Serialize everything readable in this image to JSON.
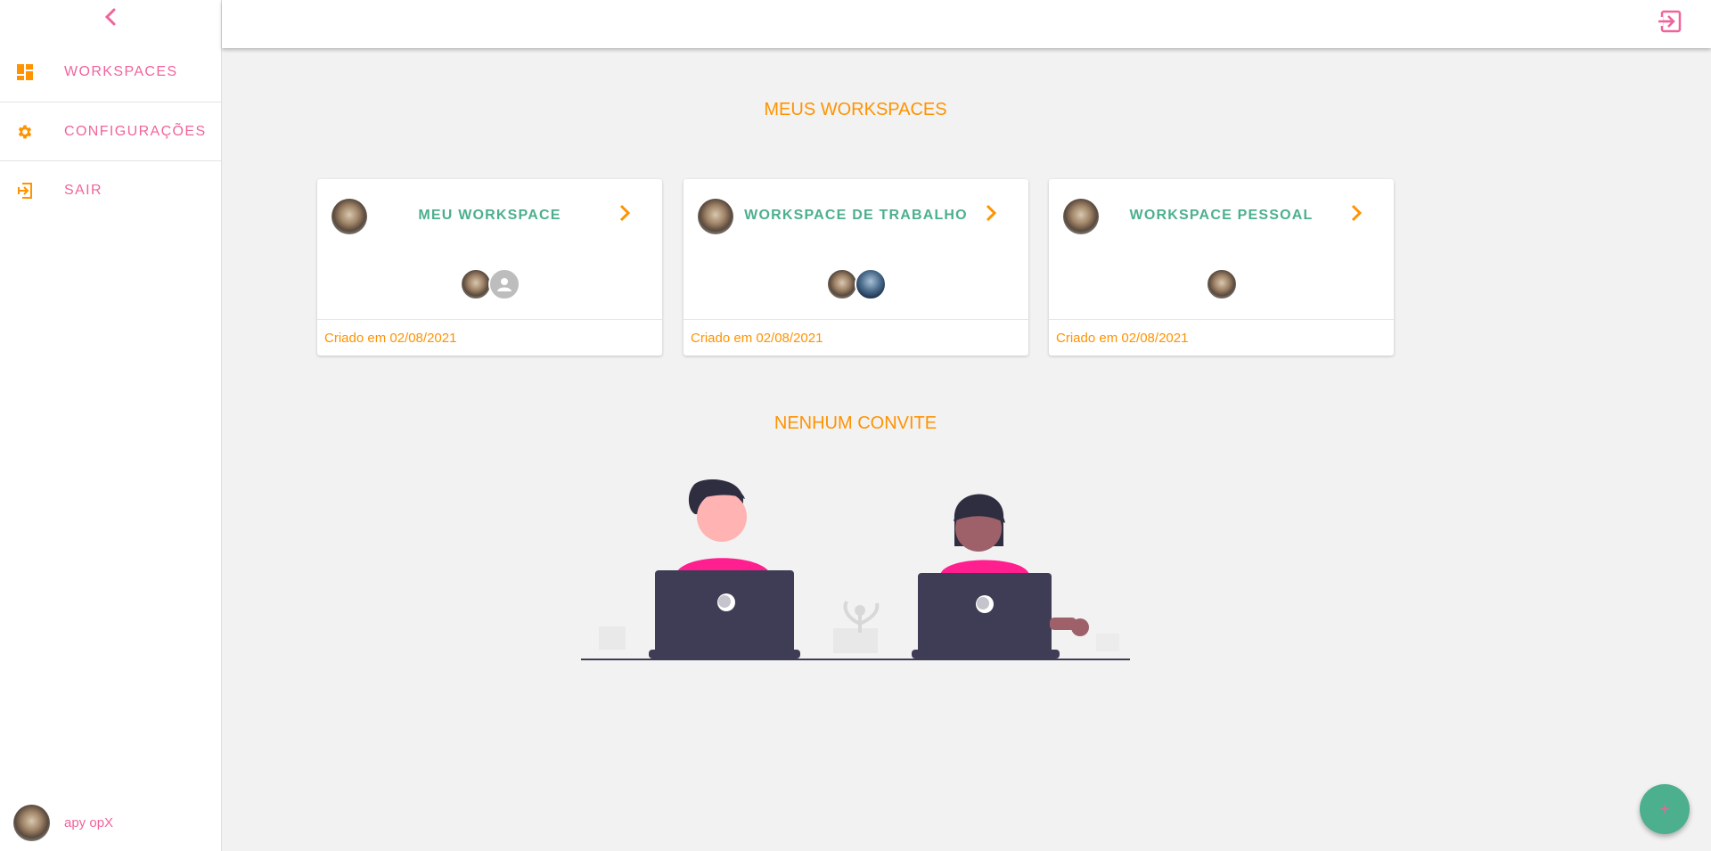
{
  "sidebar": {
    "items": [
      {
        "label": "WORKSPACES",
        "icon": "dashboard-icon"
      },
      {
        "label": "CONFIGURAÇÕES",
        "icon": "gear-icon"
      },
      {
        "label": "SAIR",
        "icon": "logout-icon"
      }
    ],
    "user": {
      "name": "apy opX"
    }
  },
  "main": {
    "workspaces_title": "MEUS WORKSPACES",
    "workspaces": [
      {
        "name": "MEU WORKSPACE",
        "created": "Criado em 02/08/2021"
      },
      {
        "name": "WORKSPACE DE TRABALHO",
        "created": "Criado em 02/08/2021"
      },
      {
        "name": "WORKSPACE PESSOAL",
        "created": "Criado em 02/08/2021"
      }
    ],
    "invites_title": "NENHUM CONVITE"
  },
  "fab": {
    "label": "+"
  },
  "colors": {
    "accent_pink": "#f0649b",
    "accent_orange": "#ff9300",
    "accent_green": "#4caf8e"
  }
}
